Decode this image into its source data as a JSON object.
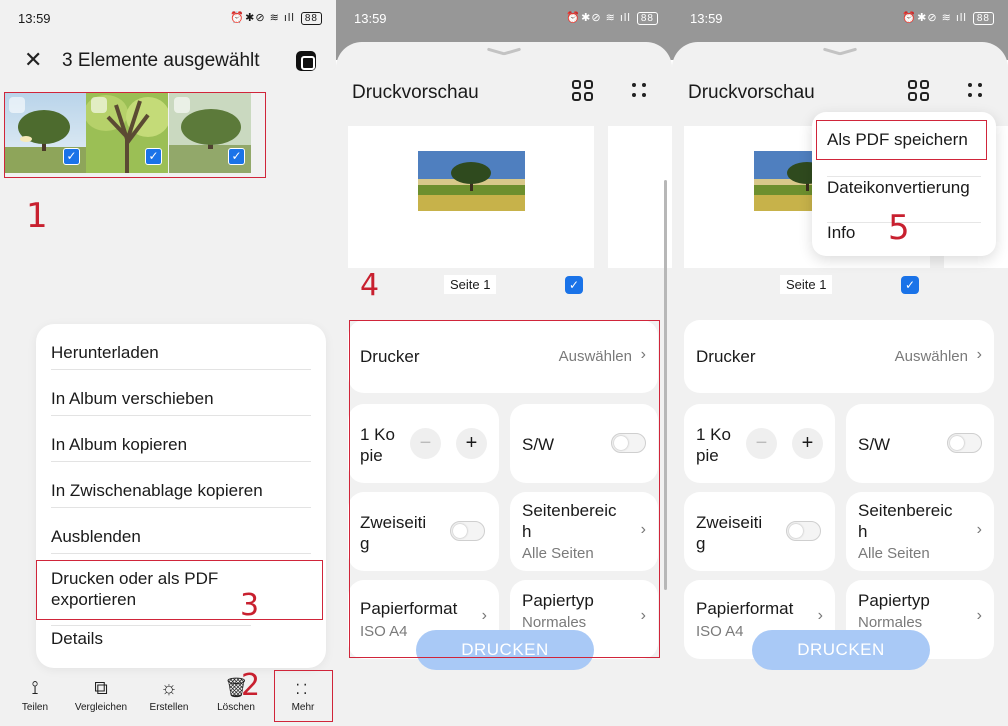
{
  "status_bar": {
    "time": "13:59",
    "icons": "⏰✱⊘ ≋ ıll",
    "battery": "88"
  },
  "screen1": {
    "header": {
      "title": "3 Elemente ausgewählt"
    },
    "thumbnails": [
      {
        "alt": "tree-photo-1",
        "selected": true
      },
      {
        "alt": "tree-photo-2",
        "selected": true
      },
      {
        "alt": "tree-photo-3",
        "selected": true
      }
    ],
    "menu_items": [
      "Herunterladen",
      "In Album verschieben",
      "In Album kopieren",
      "In Zwischenablage kopieren",
      "Ausblenden",
      "Drucken oder als PDF exportieren",
      "Details"
    ],
    "bottom_bar": [
      "Teilen",
      "Vergleichen",
      "Erstellen",
      "Löschen",
      "Mehr"
    ]
  },
  "print_sheet": {
    "title": "Druckvorschau",
    "page_label": "Seite 1",
    "printer": {
      "label": "Drucker",
      "value": "Auswählen"
    },
    "copies": {
      "label": "1 Ko\npie",
      "minus": "−",
      "plus": "+"
    },
    "bw": {
      "label": "S/W"
    },
    "duplex": {
      "label": "Zweiseiti\ng"
    },
    "page_range": {
      "label": "Seitenbereic\nh",
      "value": "Alle Seiten"
    },
    "paper_format": {
      "label": "Papierformat",
      "value": "ISO A4"
    },
    "paper_type": {
      "label": "Papiertyp",
      "value": "Normales\nPapier"
    },
    "print_button": "DRUCKEN"
  },
  "popup_menu": {
    "items": [
      "Als PDF speichern",
      "Dateikonvertierung",
      "Info"
    ]
  },
  "annotations": [
    "1",
    "2",
    "3",
    "4",
    "5"
  ],
  "colors": {
    "accent": "#1a73e8",
    "annotation_red": "#d0253a",
    "print_button_disabled": "#a9c9f6",
    "sheet_bg": "#f1f1f1"
  }
}
